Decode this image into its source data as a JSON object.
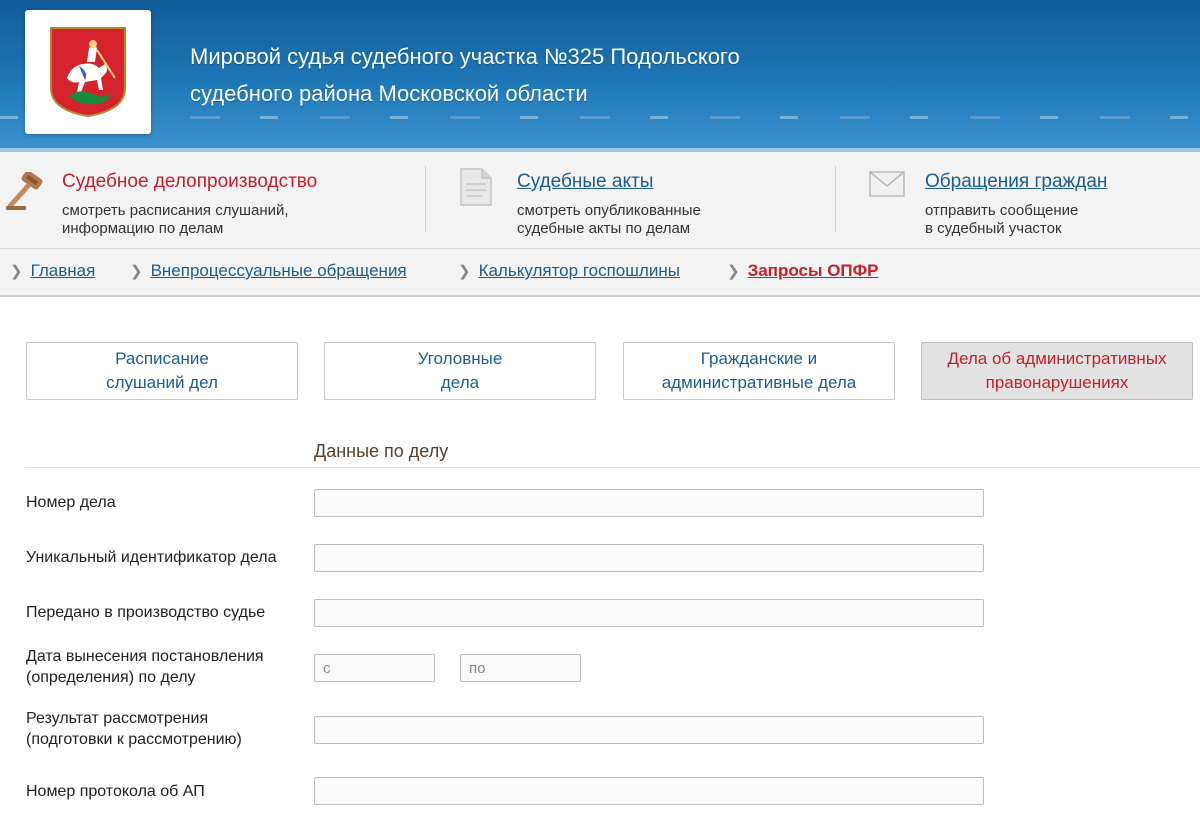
{
  "header": {
    "title_line1": "Мировой судья судебного участка №325 Подольского",
    "title_line2": "судебного района Московской области",
    "logo_icon": "moscow-coat-of-arms-icon"
  },
  "topnav": {
    "items": [
      {
        "title": "Судебное делопроизводство",
        "desc_line1": "смотреть расписания слушаний,",
        "desc_line2": "информацию по делам",
        "icon": "gavel-icon",
        "color": "#c41f2a"
      },
      {
        "title": "Судебные акты",
        "desc_line1": "смотреть опубликованные",
        "desc_line2": "судебные акты по делам",
        "icon": "document-icon",
        "color": "#1b5d91"
      },
      {
        "title": "Обращения граждан",
        "desc_line1": "отправить сообщение",
        "desc_line2": "в судебный участок",
        "icon": "envelope-icon",
        "color": "#1b5d91"
      }
    ]
  },
  "breadcrumb": [
    {
      "label": "Главная"
    },
    {
      "label": "Внепроцессуальные обращения"
    },
    {
      "label": "Калькулятор госпошлины"
    },
    {
      "label": "Запросы ОПФР",
      "active": true
    }
  ],
  "tabs": [
    {
      "line1": "Расписание",
      "line2": "слушаний дел"
    },
    {
      "line1": "Уголовные",
      "line2": "дела"
    },
    {
      "line1": "Гражданские и",
      "line2": "административные дела"
    },
    {
      "line1": "Дела об административных",
      "line2": "правонарушениях",
      "active": true
    }
  ],
  "form": {
    "section_title": "Данные по делу",
    "fields": {
      "case_number": {
        "label": "Номер дела",
        "value": ""
      },
      "unique_id": {
        "label": "Уникальный идентификатор дела",
        "value": ""
      },
      "transferred": {
        "label": "Передано в производство судье",
        "value": ""
      },
      "decision_date": {
        "label_line1": "Дата вынесения постановления",
        "label_line2": "(определения) по делу",
        "from_placeholder": "с",
        "to_placeholder": "по"
      },
      "result": {
        "label_line1": "Результат рассмотрения",
        "label_line2": "(подготовки к рассмотрению)",
        "value": ""
      },
      "protocol_number": {
        "label": "Номер протокола об АП",
        "value": ""
      }
    }
  },
  "colors": {
    "accent_red": "#c41f2a",
    "link_blue": "#1b5d91",
    "header_blue": "#1e78b8"
  }
}
